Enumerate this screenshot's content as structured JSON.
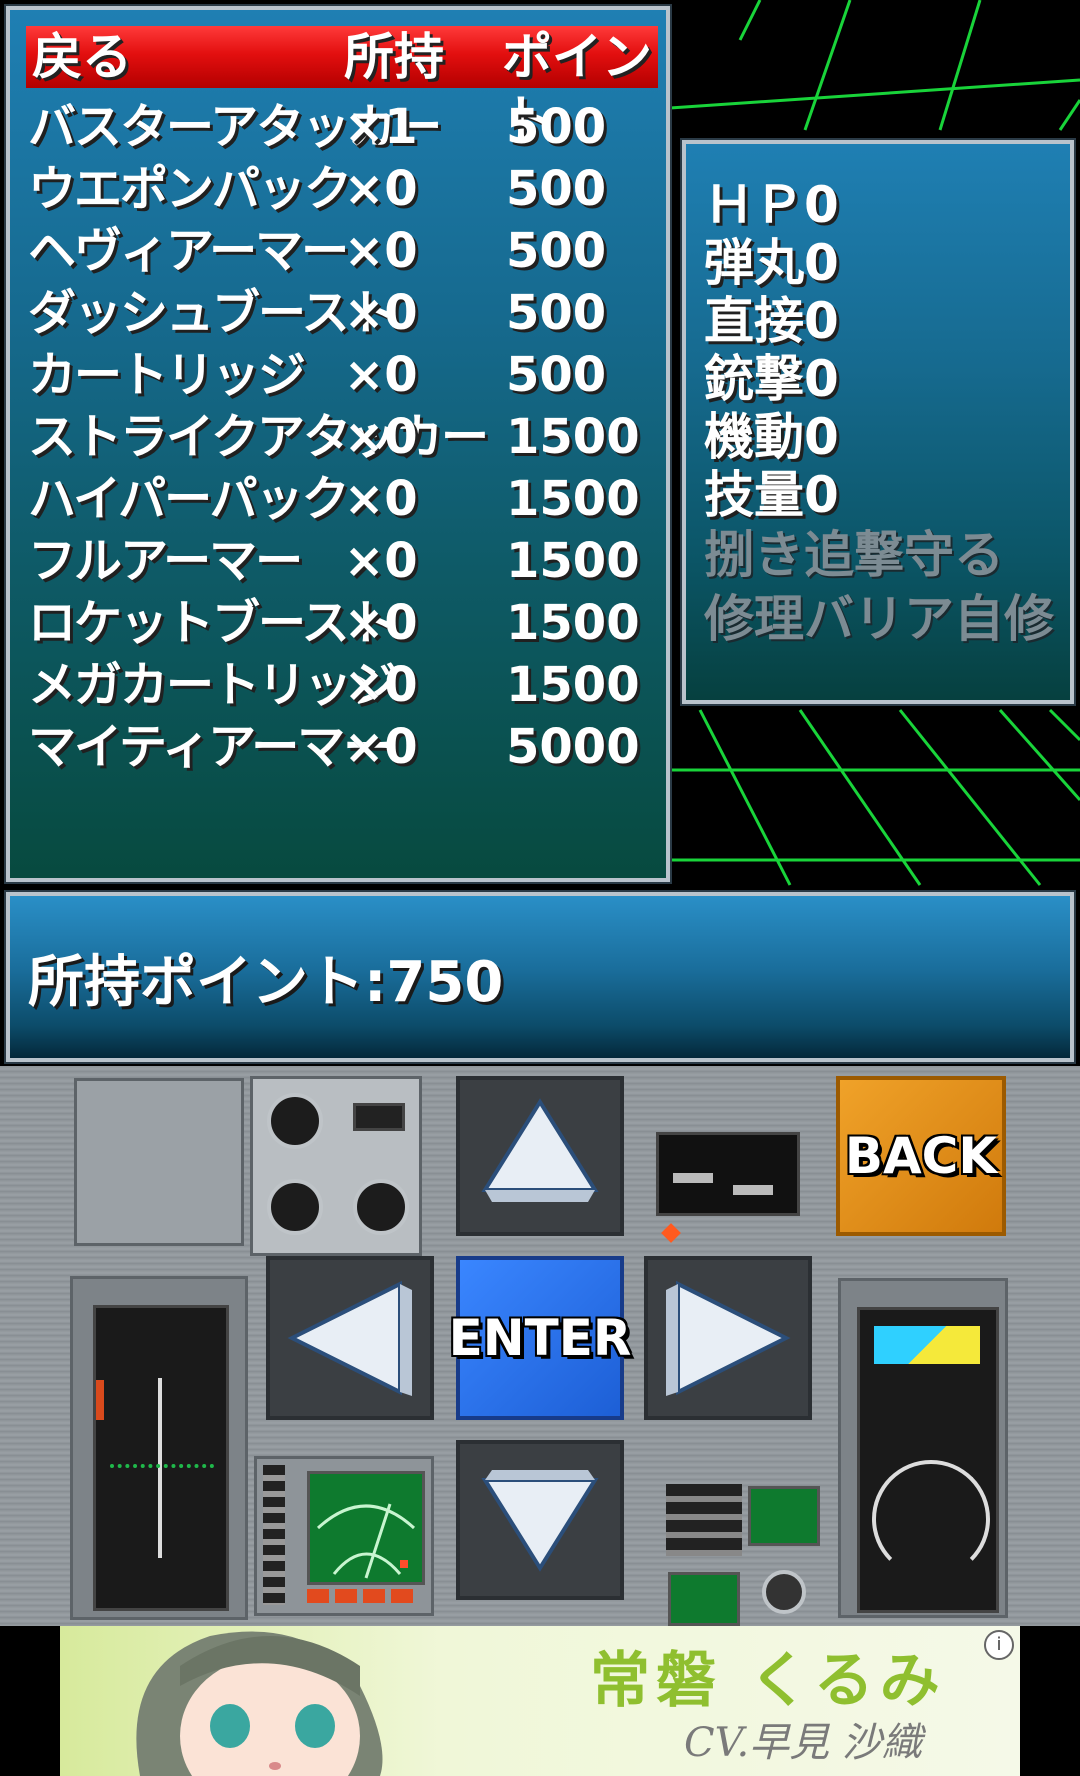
{
  "shop": {
    "header": {
      "back": "戻る",
      "owned": "所持",
      "points": "ポイント"
    },
    "items": [
      {
        "name": "バスターアタッカー",
        "owned": "×1",
        "points": "500"
      },
      {
        "name": "ウエポンパック",
        "owned": "×0",
        "points": "500"
      },
      {
        "name": "ヘヴィアーマー",
        "owned": "×0",
        "points": "500"
      },
      {
        "name": "ダッシュブースト",
        "owned": "×0",
        "points": "500"
      },
      {
        "name": "カートリッジ",
        "owned": "×0",
        "points": "500"
      },
      {
        "name": "ストライクアタッカー",
        "owned": "×0",
        "points": "1500"
      },
      {
        "name": "ハイパーパック",
        "owned": "×0",
        "points": "1500"
      },
      {
        "name": "フルアーマー",
        "owned": "×0",
        "points": "1500"
      },
      {
        "name": "ロケットブースト",
        "owned": "×0",
        "points": "1500"
      },
      {
        "name": "メガカートリッジ",
        "owned": "×0",
        "points": "1500"
      },
      {
        "name": "マイティアーマー",
        "owned": "×0",
        "points": "5000"
      }
    ]
  },
  "stats": {
    "hp": "ＨＰ0",
    "ammo": "弾丸0",
    "direct": "直接0",
    "gun": "銃撃0",
    "mobility": "機動0",
    "skill": "技量0",
    "skills_line1": "捌き追撃守る",
    "skills_line2": "修理バリア自修"
  },
  "points_bar": {
    "label": "所持ポイント:750"
  },
  "controls": {
    "enter_label": "ENTER",
    "back_label": "BACK"
  },
  "ad": {
    "title": "常磐 くるみ",
    "subtitle": "CV.早見 沙織",
    "info_icon": "i"
  }
}
